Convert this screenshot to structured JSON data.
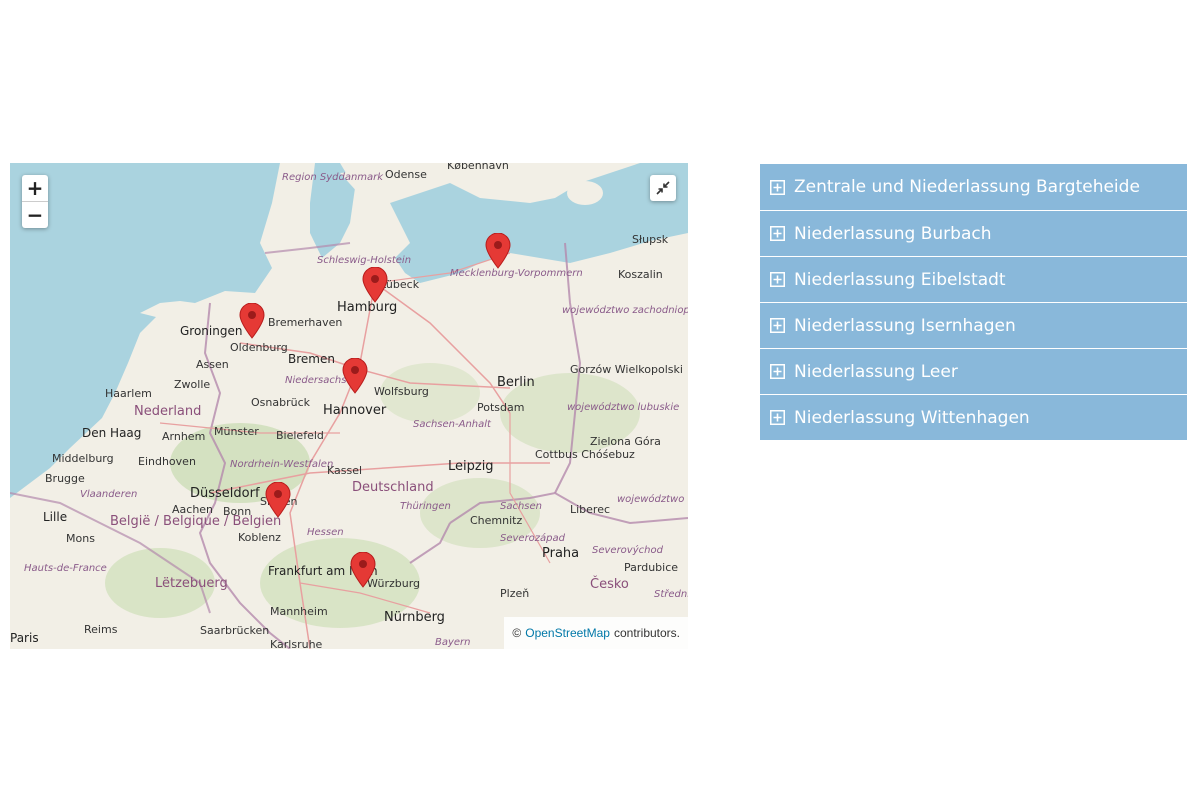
{
  "map": {
    "zoom_in_label": "+",
    "zoom_out_label": "−",
    "attribution": {
      "prefix": "©",
      "link_text": "OpenStreetMap",
      "suffix": "contributors."
    },
    "colors": {
      "sea": "#aad3df",
      "land": "#f2efe6",
      "forest": "#c8dcb0",
      "marker": "#e53935",
      "marker_dark": "#9b1b1b"
    },
    "labels": {
      "kobenhavn": "København",
      "region_syddanmark": "Region Syddanmark",
      "odense": "Odense",
      "slupsk": "Słupsk",
      "koszalin": "Koszalin",
      "schleswig_holstein": "Schleswig-Holstein",
      "lubeck": "Lübeck",
      "mecklenburg": "Mecklenburg-Vorpommern",
      "hamburg": "Hamburg",
      "zachodniopomorskie": "województwo zachodniopomorskie",
      "groningen": "Groningen",
      "bremerhaven": "Bremerhaven",
      "oldenburg": "Oldenburg",
      "assen": "Assen",
      "bremen": "Bremen",
      "gorzow": "Gorzów Wielkopolski",
      "niedersachsen": "Niedersachsen",
      "zwolle": "Zwolle",
      "wolfsburg": "Wolfsburg",
      "berlin": "Berlin",
      "haarlem": "Haarlem",
      "nederland": "Nederland",
      "osnabruck": "Osnabrück",
      "hannover": "Hannover",
      "potsdam": "Potsdam",
      "lubuskie": "województwo lubuskie",
      "den_haag": "Den Haag",
      "arnhem": "Arnhem",
      "munster": "Münster",
      "bielefeld": "Bielefeld",
      "sachsen_anhalt": "Sachsen-Anhalt",
      "cottbus": "Cottbus Chóśebuz",
      "zielona_gora": "Zielona Góra",
      "middelburg": "Middelburg",
      "eindhoven": "Eindhoven",
      "nrw": "Nordrhein-Westfalen",
      "kassel": "Kassel",
      "leipzig": "Leipzig",
      "brugge": "Brugge",
      "dusseldorf": "Düsseldorf",
      "deutschland": "Deutschland",
      "vlaanderen": "Vlaanderen",
      "aachen": "Aachen",
      "thuringen": "Thüringen",
      "sachsen": "Sachsen",
      "dolnoslaskie": "województwo dolnośląskie",
      "lille": "Lille",
      "belgie": "België / Belgique / Belgien",
      "bonn": "Bonn",
      "chemnitz": "Chemnitz",
      "liberec": "Liberec",
      "mons": "Mons",
      "koblenz": "Koblenz",
      "hessen": "Hessen",
      "severozapad": "Severozápad",
      "hauts_de_france": "Hauts-de-France",
      "frankfurt": "Frankfurt am Main",
      "wurzburg": "Würzburg",
      "praha": "Praha",
      "severovychod": "Severovýchod",
      "letzebuerg": "Lëtzebuerg",
      "pardubice": "Pardubice",
      "cesko": "Česko",
      "plzen": "Plzeň",
      "stredni": "Střední",
      "mannheim": "Mannheim",
      "nurnberg": "Nürnberg",
      "paris": "Paris",
      "reims": "Reims",
      "saarbrucken": "Saarbrücken",
      "bayern": "Bayern",
      "karlsruhe": "Karlsruhe",
      "siegen": "Siegen"
    }
  },
  "accordion": {
    "items": [
      {
        "label": "Zentrale und Niederlassung Bargteheide"
      },
      {
        "label": "Niederlassung Burbach"
      },
      {
        "label": "Niederlassung Eibelstadt"
      },
      {
        "label": "Niederlassung Isernhagen"
      },
      {
        "label": "Niederlassung Leer"
      },
      {
        "label": "Niederlassung Wittenhagen"
      }
    ]
  },
  "markers": [
    {
      "name": "Wittenhagen"
    },
    {
      "name": "Bargteheide"
    },
    {
      "name": "Leer"
    },
    {
      "name": "Isernhagen"
    },
    {
      "name": "Burbach"
    },
    {
      "name": "Eibelstadt"
    }
  ]
}
